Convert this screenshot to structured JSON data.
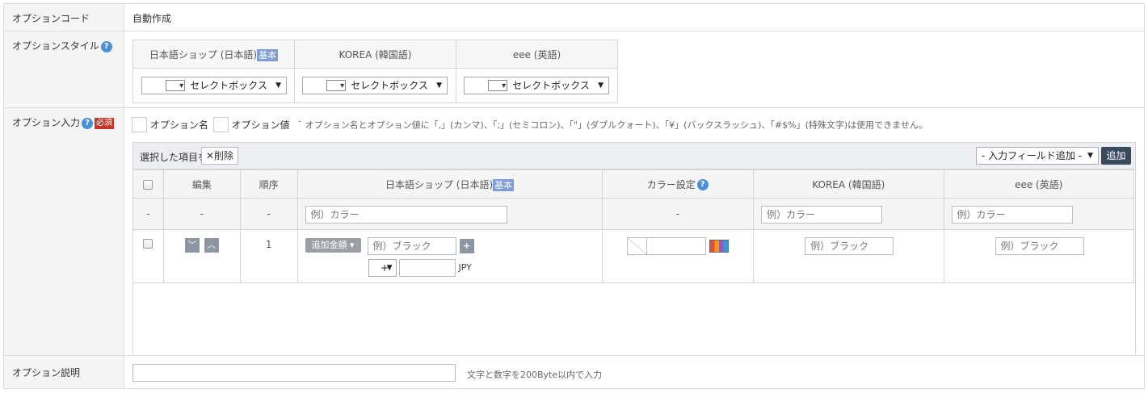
{
  "option_code": {
    "label": "オプションコード",
    "value": "自動作成"
  },
  "option_style": {
    "label": "オプションスタイル",
    "help": "?",
    "base_badge": "基本",
    "languages": [
      {
        "name": "日本語ショップ (日本語)",
        "select_value": "セレクトボックス"
      },
      {
        "name": "KOREA (韓国語)",
        "select_value": "セレクトボックス"
      },
      {
        "name": "eee (英語)",
        "select_value": "セレクトボックス"
      }
    ]
  },
  "option_input": {
    "label": "オプション入力",
    "help": "?",
    "required": "必須",
    "checkbox_name": "オプション名",
    "checkbox_value": "オプション値",
    "notice": "オプション名とオプション値に「,」(カンマ)、「;」(セミコロン)、「\"」(ダブルクォート)、「¥」(バックスラッシュ)、「#$%」(特殊文字)は使用できません。",
    "toolbar": {
      "selected_label": "選択した項目を",
      "delete_button": "✕削除",
      "add_field_select": "- 入力フィールド追加 -",
      "add_button": "追加"
    },
    "table": {
      "headers": {
        "edit": "編集",
        "order": "順序",
        "jp_shop": "日本語ショップ (日本語)",
        "base_badge": "基本",
        "color": "カラー設定",
        "color_help": "?",
        "korea": "KOREA (韓国語)",
        "eee": "eee (英語)"
      },
      "name_row": {
        "edit": "-",
        "order": "-",
        "jp_placeholder": "例）カラー",
        "color": "-",
        "korea_placeholder": "例）カラー",
        "eee_placeholder": "例）カラー"
      },
      "value_row": {
        "order": "1",
        "add_price_button": "追加金額",
        "jp_value_placeholder": "例）ブラック",
        "plus_button": "+",
        "sign_select": "+",
        "currency": "JPY",
        "korea_placeholder": "例）ブラック",
        "eee_placeholder": "例）ブラック"
      }
    }
  },
  "option_description": {
    "label": "オプション説明",
    "input_value": "",
    "hint": "文字と数字を200Byte以内で入力"
  }
}
